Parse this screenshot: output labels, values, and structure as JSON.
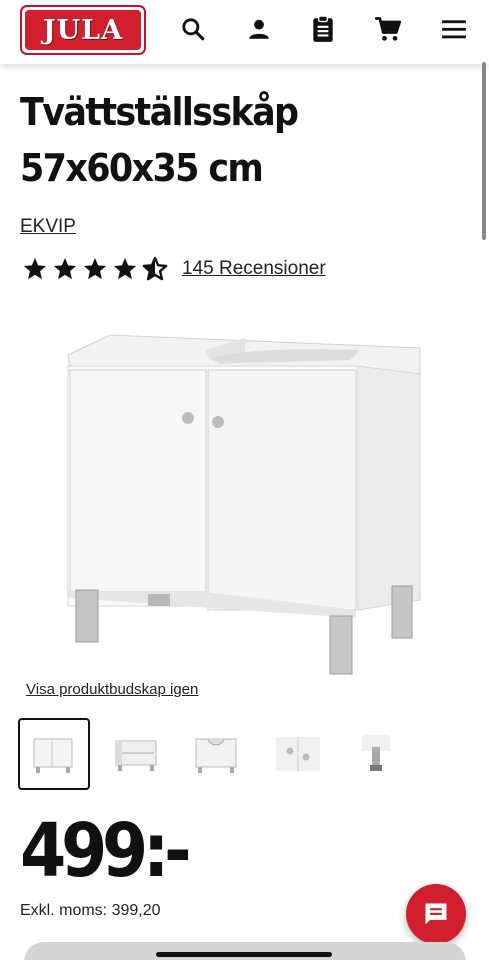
{
  "header": {
    "logo_text": "JULA",
    "icons": [
      "search-icon",
      "user-icon",
      "clipboard-icon",
      "cart-icon",
      "menu-icon"
    ],
    "brand_color": "#d11f2d"
  },
  "product": {
    "title": "Tvättställsskåp 57x60x35 cm",
    "brand": "EKVIP",
    "rating": 4.5,
    "reviews_label": "145 Recensioner",
    "revisit_link": "Visa produktbudskap igen",
    "thumbnails": [
      "thumbnail-front",
      "thumbnail-open",
      "thumbnail-sink-cutout",
      "thumbnail-knobs",
      "thumbnail-leg"
    ],
    "selected_thumbnail": 0
  },
  "pricing": {
    "price": "499:-",
    "excl_vat": "Exkl. moms: 399,20"
  },
  "chat": {
    "icon": "chat-icon"
  }
}
